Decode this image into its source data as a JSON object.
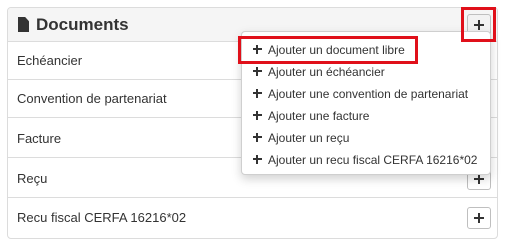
{
  "panel": {
    "title": "Documents",
    "title_icon": "document-icon",
    "add_icon": "plus-icon"
  },
  "rows": [
    {
      "label": "Echéancier"
    },
    {
      "label": "Convention de partenariat"
    },
    {
      "label": "Facture"
    },
    {
      "label": "Reçu"
    },
    {
      "label": "Recu fiscal CERFA 16216*02"
    }
  ],
  "dropdown": {
    "items": [
      {
        "label": "Ajouter un document libre"
      },
      {
        "label": "Ajouter un échéancier"
      },
      {
        "label": "Ajouter une convention de partenariat"
      },
      {
        "label": "Ajouter une facture"
      },
      {
        "label": "Ajouter un reçu"
      },
      {
        "label": "Ajouter un recu fiscal CERFA 16216*02"
      }
    ]
  },
  "colors": {
    "highlight": "#e0101a",
    "text": "#333333",
    "header_bg": "#f5f5f5"
  }
}
